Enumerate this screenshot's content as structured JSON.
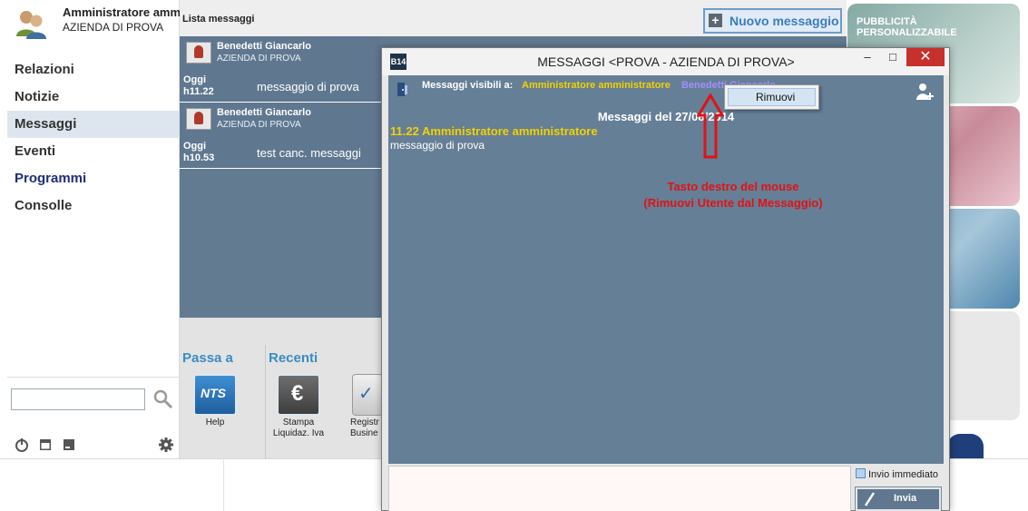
{
  "user": {
    "name": "Amministratore amm",
    "company": "AZIENDA DI PROVA",
    "avatar_icon": "users-icon"
  },
  "nav": {
    "items": [
      {
        "label": "Relazioni"
      },
      {
        "label": "Notizie"
      },
      {
        "label": "Messaggi"
      },
      {
        "label": "Eventi"
      },
      {
        "label": "Programmi"
      },
      {
        "label": "Consolle"
      }
    ],
    "active": "Messaggi"
  },
  "sidebar_footer": {
    "search_placeholder": "",
    "icons": [
      "search-icon",
      "power-icon",
      "calendar-icon",
      "window-icon",
      "gear-icon"
    ]
  },
  "list": {
    "title": "Lista messaggi",
    "new_message_label": "Nuovo messaggio",
    "messages": [
      {
        "sender": "Benedetti Giancarlo",
        "company": "AZIENDA DI PROVA",
        "day": "Oggi",
        "time": "h11.22",
        "text": "messaggio di prova"
      },
      {
        "sender": "Benedetti Giancarlo",
        "company": "AZIENDA DI PROVA",
        "day": "Oggi",
        "time": "h10.53",
        "text": "test canc. messaggi"
      }
    ]
  },
  "bottom": {
    "passa_title": "Passa a",
    "recenti_title": "Recenti",
    "tiles": [
      {
        "label": "Help",
        "icon": "nts-icon"
      },
      {
        "label": "Stampa Liquidaz. Iva",
        "icon": "euro-icon"
      },
      {
        "label": "Registr Busine",
        "icon": "registry-icon"
      }
    ]
  },
  "ads": {
    "title": "PUBBLICITÀ PERSONALIZZABILE"
  },
  "dialog": {
    "app_icon_text": "B14",
    "title": "MESSAGGI <PROVA - AZIENDA DI PROVA>",
    "minimize": "–",
    "maximize": "□",
    "close": "✕",
    "recipients_label": "Messaggi visibili a:",
    "recipient_1": "Amministratore amministratore",
    "recipient_2": "Benedetti Giancarlo",
    "day_header": "Messaggi del 27/08/2014",
    "message_title": "11.22 Amministratore amministratore",
    "message_body": "messaggio di prova",
    "note_line1": "Tasto destro del mouse",
    "note_line2": "(Rimuovi Utente dal Messaggio)",
    "context_menu_item": "Rimuovi",
    "immediate_label": "Invio immediato",
    "send_label": "Invia",
    "colors": {
      "panel": "#657f97",
      "highlight_user": "#f2d100",
      "second_user": "#a28fff",
      "annotation": "#e01313",
      "close_button": "#c7302b"
    }
  }
}
